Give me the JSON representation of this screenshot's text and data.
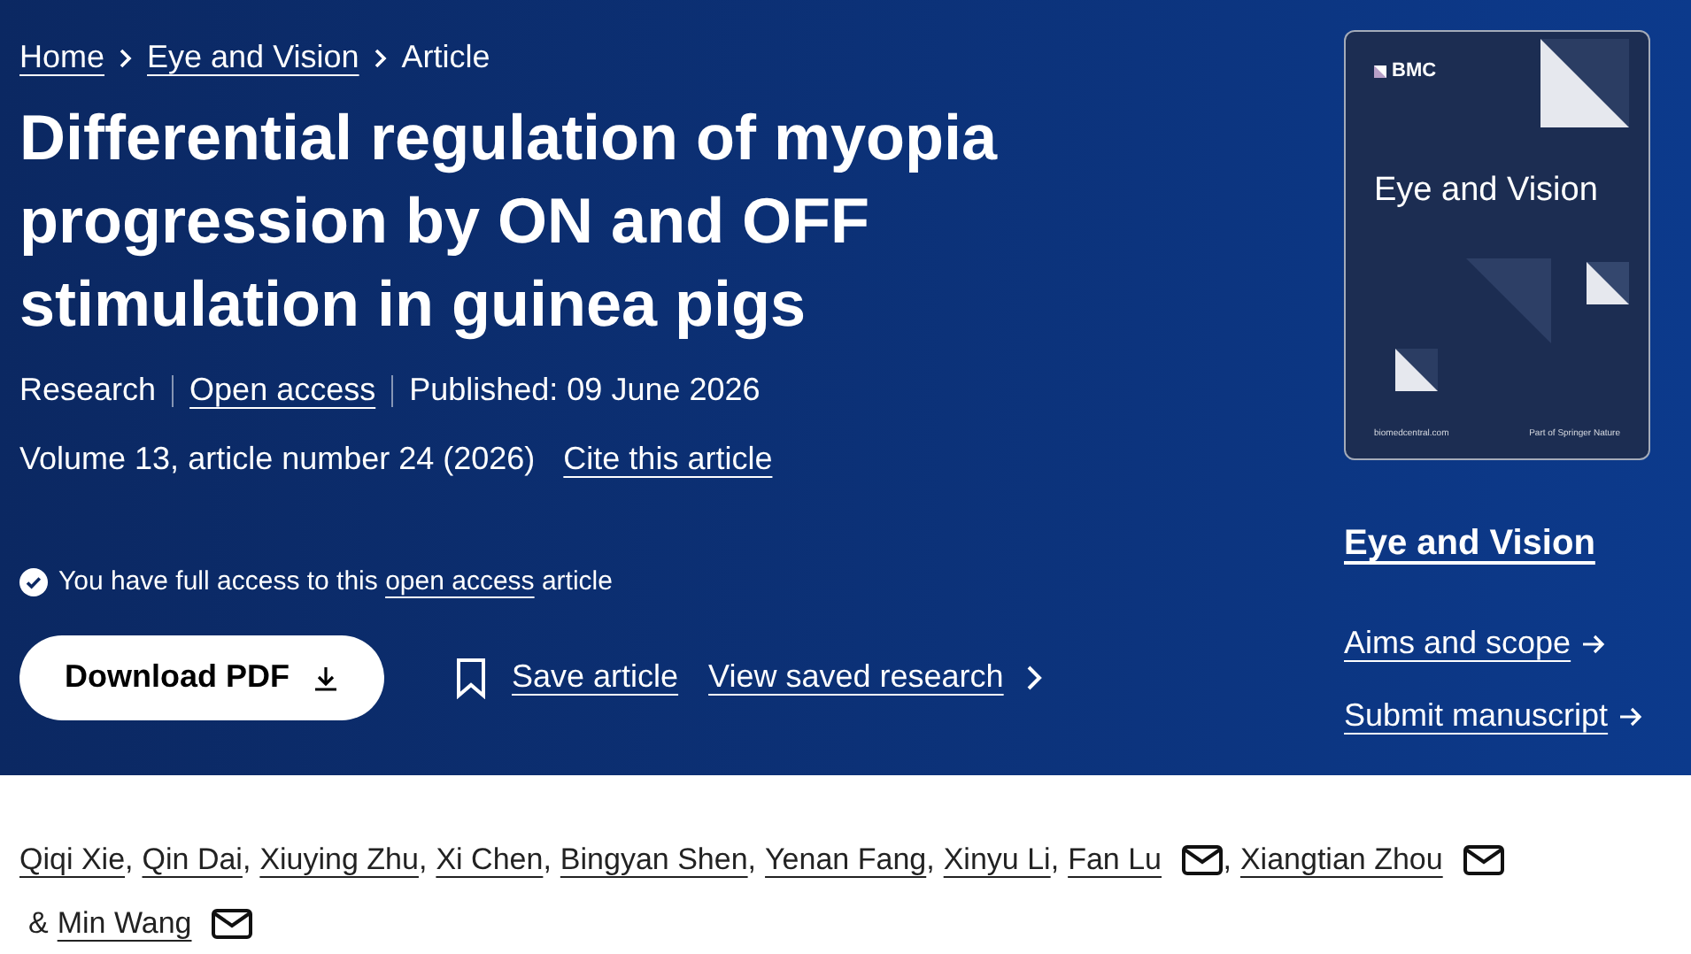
{
  "breadcrumb": [
    {
      "label": "Home"
    },
    {
      "label": "Eye and Vision"
    },
    {
      "label": "Article"
    }
  ],
  "title": "Differential regulation of myopia progression by ON and OFF stimulation in guinea pigs",
  "meta": {
    "type": "Research",
    "access": "Open access",
    "published": "Published: 09 June 2026",
    "volume": "Volume 13, article number 24 (2026)",
    "cite": "Cite this article"
  },
  "access_note": {
    "before": "You have full access to this",
    "link": "open access",
    "after": "article"
  },
  "actions": {
    "download": "Download PDF",
    "save": "Save article",
    "saved": "View saved research"
  },
  "journal": {
    "cover": {
      "publisher": "BMC",
      "title": "Eye and Vision",
      "url": "biomedcentral.com",
      "footer": "Part of Springer Nature"
    },
    "name": "Eye and Vision",
    "links": [
      {
        "label": "Aims and scope"
      },
      {
        "label": "Submit manuscript"
      }
    ]
  },
  "authors": [
    {
      "name": "Qiqi Xie",
      "email": false,
      "after": ","
    },
    {
      "name": "Qin Dai",
      "email": false,
      "after": ","
    },
    {
      "name": "Xiuying Zhu",
      "email": false,
      "after": ","
    },
    {
      "name": "Xi Chen",
      "email": false,
      "after": ","
    },
    {
      "name": "Bingyan Shen",
      "email": false,
      "after": ","
    },
    {
      "name": "Yenan Fang",
      "email": false,
      "after": ","
    },
    {
      "name": "Xinyu Li",
      "email": false,
      "after": ","
    },
    {
      "name": "Fan Lu",
      "email": true,
      "after": ","
    },
    {
      "name": "Xiangtian Zhou",
      "email": true,
      "after": "&"
    },
    {
      "name": "Min Wang",
      "email": true
    }
  ]
}
